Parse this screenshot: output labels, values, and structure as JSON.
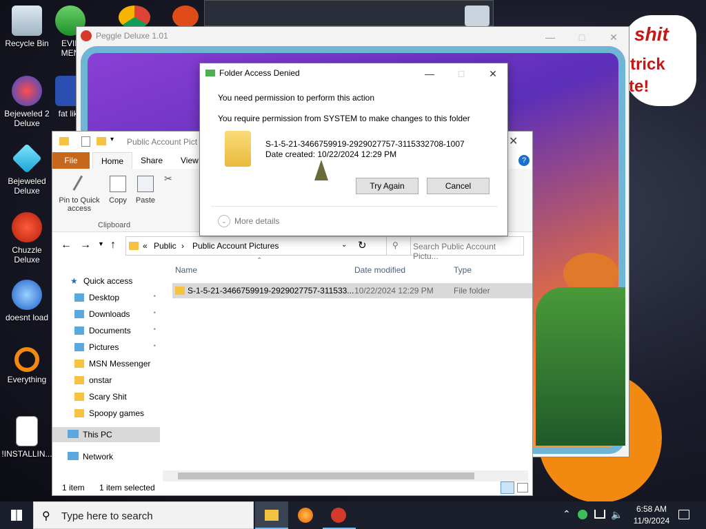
{
  "desktop_icons": [
    {
      "label": "Recycle Bin",
      "icon": "recycle-bin-icon"
    },
    {
      "label": "EVIL\nMEN",
      "icon": "msn-people-icon"
    },
    {
      "label": "Bejeweled 2\nDeluxe",
      "icon": "bejeweled2-icon"
    },
    {
      "label": "fat like",
      "icon": "app-shortcut-icon"
    },
    {
      "label": "Bejeweled\nDeluxe",
      "icon": "gem-icon"
    },
    {
      "label": "Chuzzle\nDeluxe",
      "icon": "chuzzle-icon"
    },
    {
      "label": "doesnt load",
      "icon": "thunderbird-icon"
    },
    {
      "label": "Everything",
      "icon": "everything-search-icon"
    },
    {
      "label": "!INSTALLIN...",
      "icon": "text-file-icon"
    }
  ],
  "background_text": {
    "line1": "shit",
    "line2": "trick",
    "line3": "te!"
  },
  "peggle": {
    "title": "Peggle Deluxe 1.01"
  },
  "dialog": {
    "title": "Folder Access Denied",
    "heading": "You need permission to perform this action",
    "message": "You require permission from SYSTEM to make changes to this folder",
    "folder_name": "S-1-5-21-3466759919-2929027757-3115332708-1007",
    "date_created": "Date created: 10/22/2024 12:29 PM",
    "try_again": "Try Again",
    "cancel": "Cancel",
    "more_details": "More details"
  },
  "explorer": {
    "title": "Public Account Pict",
    "tabs": {
      "file": "File",
      "home": "Home",
      "share": "Share",
      "view": "View"
    },
    "ribbon": {
      "pin_label": "Pin to Quick access",
      "copy_label": "Copy",
      "paste_label": "Paste",
      "clipboard_group": "Clipboard"
    },
    "address": {
      "root": "Public",
      "current": "Public Account Pictures"
    },
    "search_placeholder": "Search Public Account Pictu...",
    "nav": {
      "quick_access": "Quick access",
      "items": [
        {
          "label": "Desktop",
          "pinned": true
        },
        {
          "label": "Downloads",
          "pinned": true
        },
        {
          "label": "Documents",
          "pinned": true
        },
        {
          "label": "Pictures",
          "pinned": true
        },
        {
          "label": "MSN Messenger",
          "pinned": false
        },
        {
          "label": "onstar",
          "pinned": false
        },
        {
          "label": "Scary Shit",
          "pinned": false
        },
        {
          "label": "Spoopy games",
          "pinned": false
        }
      ],
      "this_pc": "This PC",
      "network": "Network"
    },
    "columns": {
      "name": "Name",
      "date": "Date modified",
      "type": "Type"
    },
    "rows": [
      {
        "name": "S-1-5-21-3466759919-2929027757-311533...",
        "date": "10/22/2024 12:29 PM",
        "type": "File folder"
      }
    ],
    "status": {
      "count": "1 item",
      "selected": "1 item selected"
    }
  },
  "taskbar": {
    "search_placeholder": "Type here to search",
    "time": "6:58 AM",
    "date": "11/9/2024"
  },
  "colors": {
    "ribbon_file": "#c7671b",
    "accent": "#0078d7"
  }
}
